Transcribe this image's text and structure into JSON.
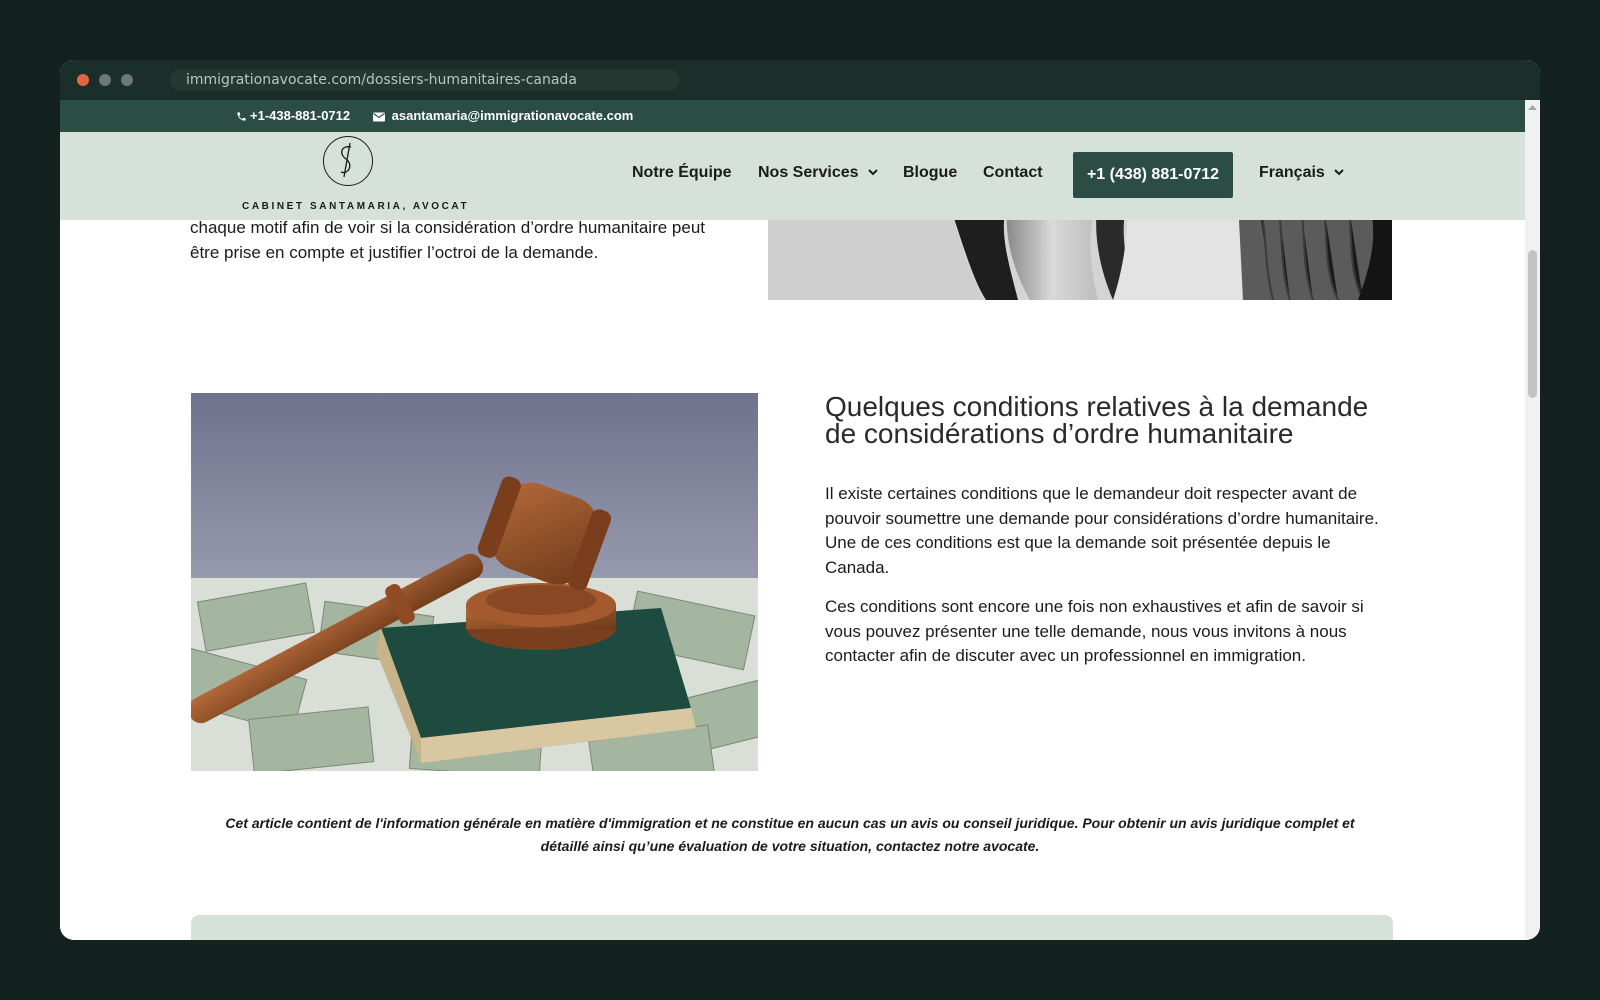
{
  "browser": {
    "url": "immigrationavocate.com/dossiers-humanitaires-canada"
  },
  "topbar": {
    "phone": "+1-438-881-0712",
    "email": "asantamaria@immigrationavocate.com"
  },
  "nav": {
    "logo_text": "CABINET SANTAMARIA, AVOCAT",
    "items": [
      {
        "label": "Notre Équipe"
      },
      {
        "label": "Nos Services"
      },
      {
        "label": "Blogue"
      },
      {
        "label": "Contact"
      }
    ],
    "cta_label": "+1 (438) 881-0712",
    "language": "Français"
  },
  "content": {
    "intro_paragraph": "chaque motif afin de voir si la considération d’ordre humanitaire peut être prise en compte et justifier l’octroi de la demande.",
    "section_title": "Quelques conditions relatives à la demande de considérations d’ordre humanitaire",
    "paragraph1": "Il existe certaines conditions que le demandeur doit respecter avant de pouvoir soumettre une demande pour considérations d’ordre humanitaire. Une de ces conditions est que la demande soit présentée depuis le Canada.",
    "paragraph2": "Ces conditions sont encore une fois non exhaustives et afin de savoir si vous pouvez présenter une telle demande, nous vous invitons à nous contacter afin de discuter avec un professionnel en immigration.",
    "disclaimer": "Cet article contient de l'information générale en matière d'immigration et ne constitue en aucun cas un avis ou conseil juridique. Pour obtenir un avis juridique complet et détaillé ainsi qu’une évaluation de votre situation, contactez notre avocate."
  },
  "colors": {
    "brand_dark_green": "#2c4d44",
    "nav_background": "#d6e1d9",
    "page_background": "#13221f"
  }
}
